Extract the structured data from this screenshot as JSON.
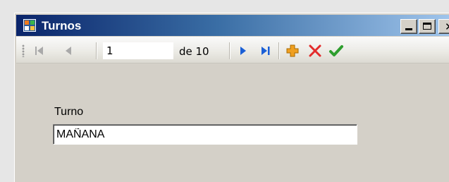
{
  "window": {
    "title": "Turnos"
  },
  "titlebar_buttons": {
    "minimize": "minimize",
    "maximize": "maximize",
    "close": "✕"
  },
  "navigator": {
    "position": "1",
    "count_label": "de 10",
    "icons": [
      "move-first-icon",
      "move-previous-icon",
      "move-next-icon",
      "move-last-icon",
      "add-icon",
      "delete-icon",
      "save-icon"
    ]
  },
  "form": {
    "turno_label": "Turno",
    "turno_value": "MAÑANA"
  },
  "colors": {
    "titlebar_start": "#0a246a",
    "titlebar_end": "#a6caf0",
    "nav_blue": "#1a5fd6",
    "add_orange": "#f0a020",
    "delete_red": "#e32b2b",
    "save_green": "#2e9e2e"
  }
}
